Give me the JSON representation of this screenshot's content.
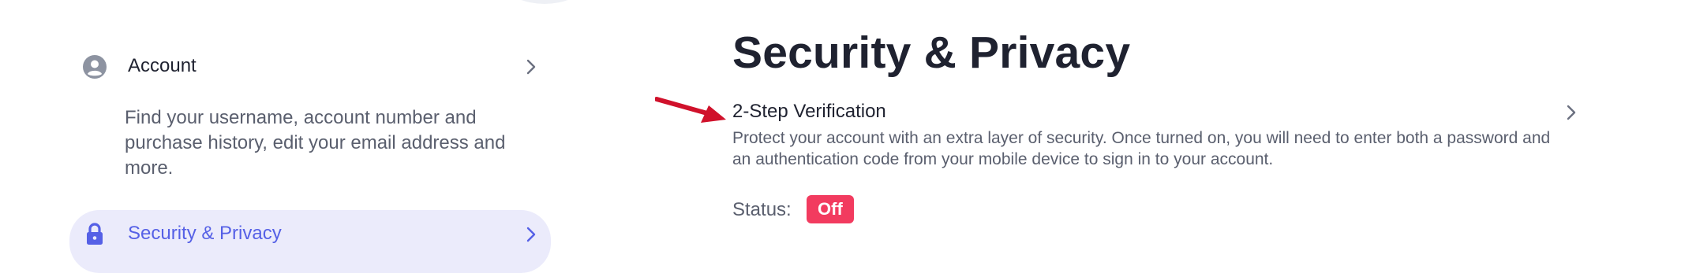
{
  "sidebar": {
    "items": [
      {
        "label": "Account",
        "description": "Find your username, account number and purchase history, edit your email address and more.",
        "icon": "user-circle-icon"
      },
      {
        "label": "Security & Privacy",
        "icon": "lock-icon",
        "active": true
      }
    ]
  },
  "main": {
    "title": "Security & Privacy",
    "settings": [
      {
        "title": "2-Step Verification",
        "description": "Protect your account with an extra layer of security. Once turned on, you will need to enter both a password and an authentication code from your mobile device to sign in to your account.",
        "status_label": "Status:",
        "status_value": "Off"
      }
    ]
  },
  "colors": {
    "accent": "#5560e6",
    "active_bg": "#ebebfb",
    "status_off": "#f23b5f",
    "annotation_arrow": "#d0112b",
    "text_primary": "#1f2230",
    "text_secondary": "#5a5f6e"
  }
}
